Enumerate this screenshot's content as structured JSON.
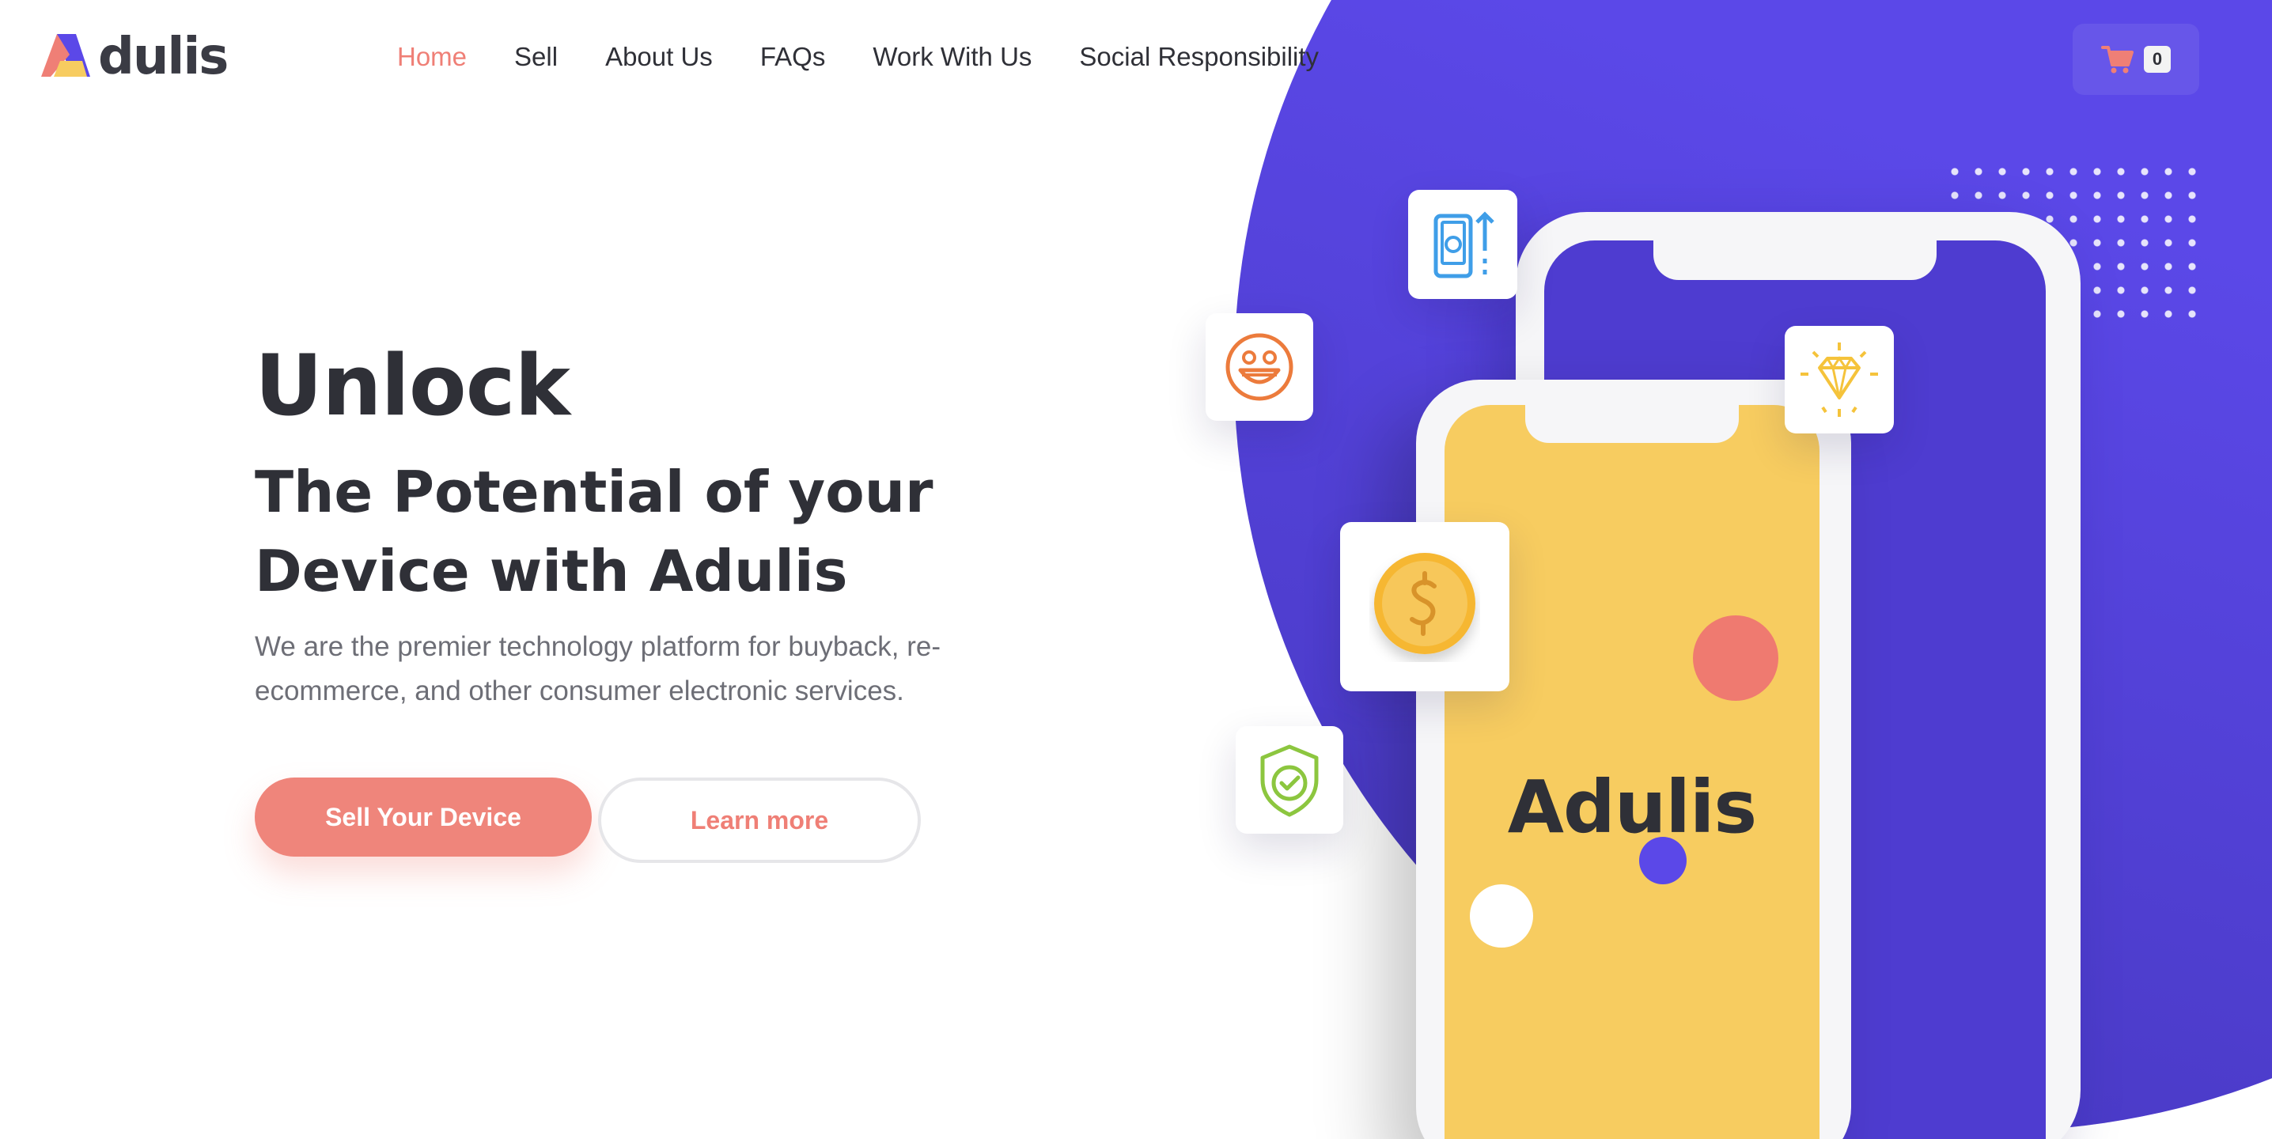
{
  "brand": {
    "logo_text": "dulis",
    "logo_letter": "A",
    "colors": {
      "primary": "#ef857b",
      "accent_purple": "#5b48e8",
      "accent_yellow": "#f7cc60",
      "text_dark": "#2f3037"
    }
  },
  "nav": {
    "items": [
      {
        "label": "Home",
        "active": true
      },
      {
        "label": "Sell",
        "active": false
      },
      {
        "label": "About Us",
        "active": false
      },
      {
        "label": "FAQs",
        "active": false
      },
      {
        "label": "Work With Us",
        "active": false
      },
      {
        "label": "Social Responsibility",
        "active": false
      }
    ]
  },
  "cart": {
    "icon": "cart-icon",
    "count": "0"
  },
  "hero": {
    "title": "Unlock",
    "subtitle": "The Potential of your Device with Adulis",
    "description": "We are the premier technology platform for buyback, re-ecommerce, and other consumer electronic services.",
    "primary_button": "Sell Your Device",
    "secondary_button": "Learn more"
  },
  "illustration": {
    "phone_brand_text": "Adulis",
    "icons": [
      "phone-upload-icon",
      "smiley-icon",
      "diamond-icon",
      "coin-dollar-icon",
      "shield-check-icon"
    ]
  }
}
